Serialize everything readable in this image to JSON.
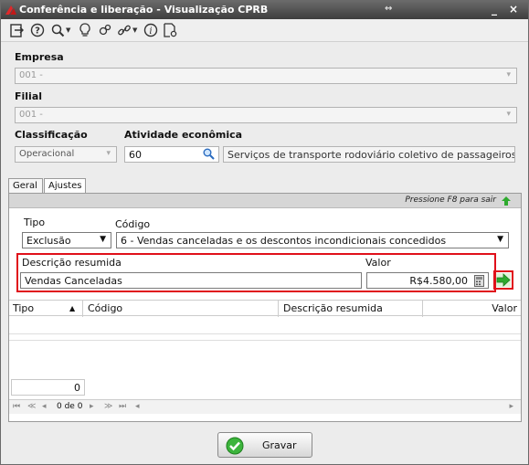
{
  "window": {
    "title": "Conferência e liberação - Visualização CPRB",
    "minimize": "_",
    "close": "×"
  },
  "form": {
    "empresa_label": "Empresa",
    "empresa_value": "001 -",
    "filial_label": "Filial",
    "filial_value": "001 -",
    "classificacao_label": "Classificação",
    "classificacao_value": "Operacional",
    "atividade_label": "Atividade econômica",
    "atividade_code": "60",
    "atividade_desc": "Serviços de transporte rodoviário coletivo de passageiros, ..."
  },
  "tabs": [
    {
      "label": "Geral"
    },
    {
      "label": "Ajustes"
    }
  ],
  "ajustes": {
    "hint": "Pressione F8 para sair",
    "tipo_label": "Tipo",
    "tipo_value": "Exclusão",
    "codigo_label": "Código",
    "codigo_value": "6 - Vendas canceladas e os descontos incondicionais concedidos",
    "descricao_label": "Descrição resumida",
    "descricao_value": "Vendas Canceladas",
    "valor_label": "Valor",
    "valor_value": "R$4.580,00"
  },
  "grid": {
    "columns": [
      "Tipo",
      "Código",
      "Descrição resumida",
      "Valor"
    ],
    "count": "0",
    "pager_text": "0 de 0"
  },
  "footer": {
    "save_label": "Gravar"
  },
  "colors": {
    "highlight": "#e0101a",
    "accent_green": "#2eaa2e"
  }
}
